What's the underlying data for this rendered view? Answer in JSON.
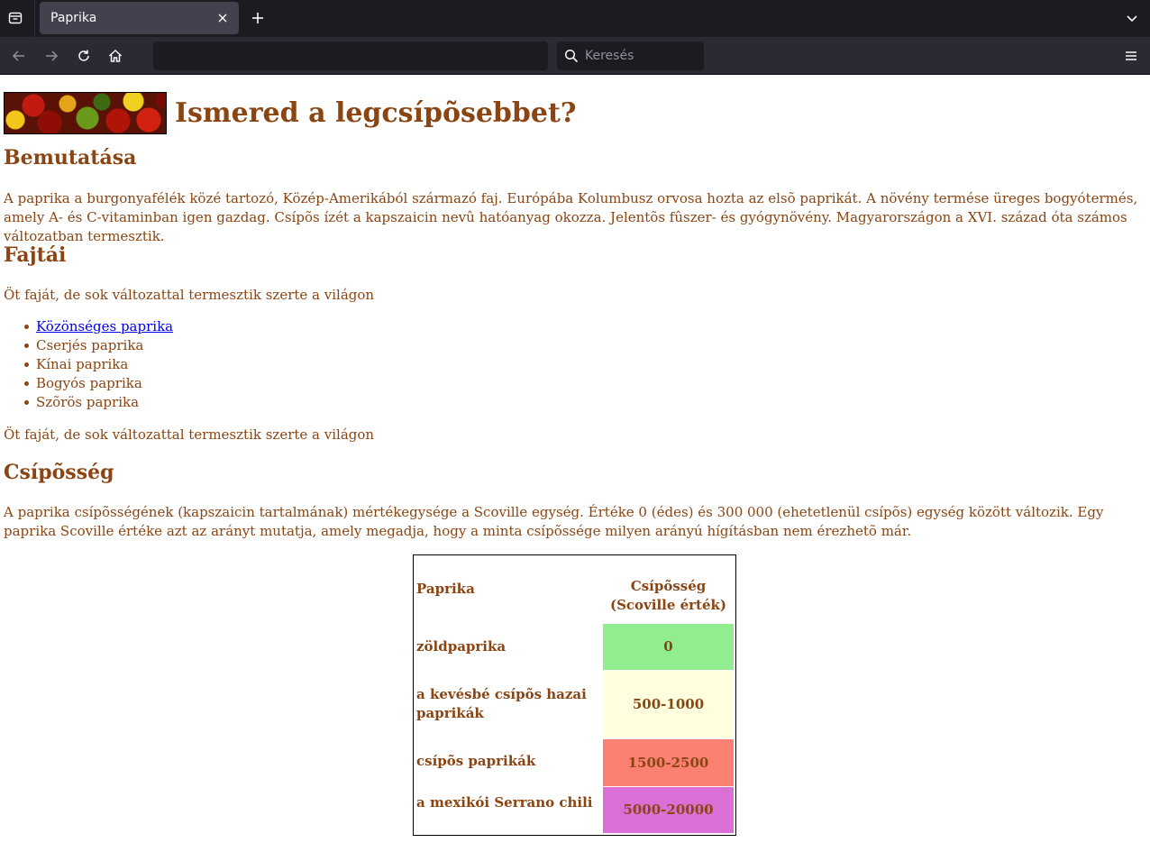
{
  "browser": {
    "tab_title": "Paprika",
    "search_placeholder": "Keresés"
  },
  "page": {
    "title": "Ismered a legcsípõsebbet?",
    "sections": {
      "intro": {
        "heading": "Bemutatása",
        "text": "A paprika a burgonyafélék közé tartozó, Közép-Amerikából származó faj. Európába Kolumbusz orvosa hozta az elsõ paprikát. A növény termése üreges bogyótermés, amely A- és C-vitaminban igen gazdag. Csípõs ízét a kapszaicin nevû hatóanyag okozza. Jelentõs fûszer- és gyógynövény. Magyarországon a XVI. század óta számos változatban termesztik."
      },
      "types": {
        "heading": "Fajtái",
        "text_before": "Öt faját, de sok változattal termesztik szerte a világon",
        "items": [
          "Közönséges paprika",
          "Cserjés paprika",
          "Kínai paprika",
          "Bogyós paprika",
          "Szõrös paprika"
        ],
        "text_after": "Öt faját, de sok változattal termesztik szerte a világon"
      },
      "heat": {
        "heading": "Csípõsség",
        "text": "A paprika csípõsségének (kapszaicin tartalmának) mértékegysége a Scoville egység. Értéke 0 (édes) és 300 000 (ehetetlenül csípõs) egység között változik. Egy paprika Scoville értéke azt az arányt mutatja, amely megadja, hogy a minta csípõssége milyen arányú hígításban nem érezhetõ már."
      }
    },
    "table": {
      "headers": [
        "Paprika",
        "Csípõsség (Scoville érték)"
      ],
      "rows": [
        {
          "name": "zöldpaprika",
          "value": "0",
          "color": "#90ee90"
        },
        {
          "name": "a kevésbé csípõs hazai paprikák",
          "value": "500-1000",
          "color": "#ffffe0"
        },
        {
          "name": "csípõs paprikák",
          "value": "1500-2500",
          "color": "#fa8072"
        },
        {
          "name": "a mexikói Serrano chili",
          "value": "5000-20000",
          "color": "#da70d6"
        }
      ]
    }
  },
  "colors": {
    "text": "#8b4513",
    "link": "#0000ee"
  }
}
